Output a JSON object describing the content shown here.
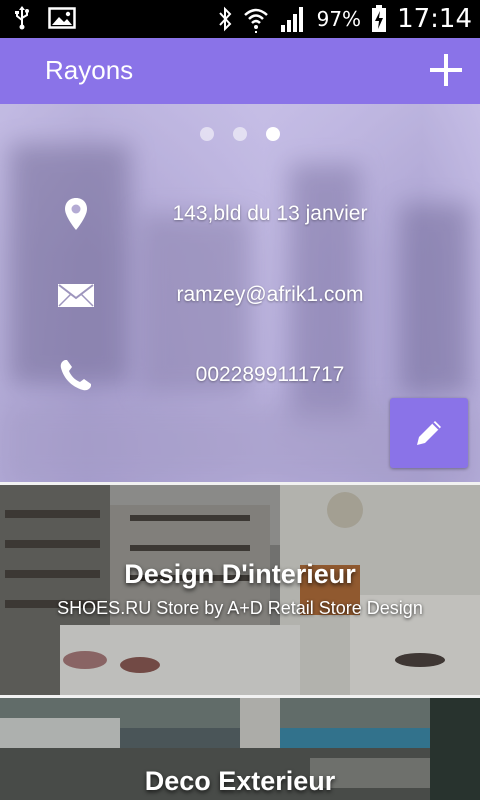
{
  "status_bar": {
    "battery": "97%",
    "time": "17:14",
    "icons": [
      "usb-icon",
      "image-icon",
      "bluetooth-icon",
      "wifi-icon",
      "signal-icon",
      "battery-charging-icon"
    ]
  },
  "action_bar": {
    "title": "Rayons",
    "add_icon": "plus-icon"
  },
  "shop": {
    "pager": {
      "count": 3,
      "active_index": 2
    },
    "address": "143,bld du 13 janvier",
    "email": "ramzey@afrik1.com",
    "phone": "0022899111717",
    "edit_icon": "pencil-icon"
  },
  "categories": [
    {
      "title": "Design D'interieur",
      "subtitle": "SHOES.RU Store by A+D Retail Store Design"
    },
    {
      "title": "Deco Exterieur",
      "subtitle": ""
    }
  ],
  "colors": {
    "accent": "#8a73e8",
    "status_bar": "#000000"
  }
}
